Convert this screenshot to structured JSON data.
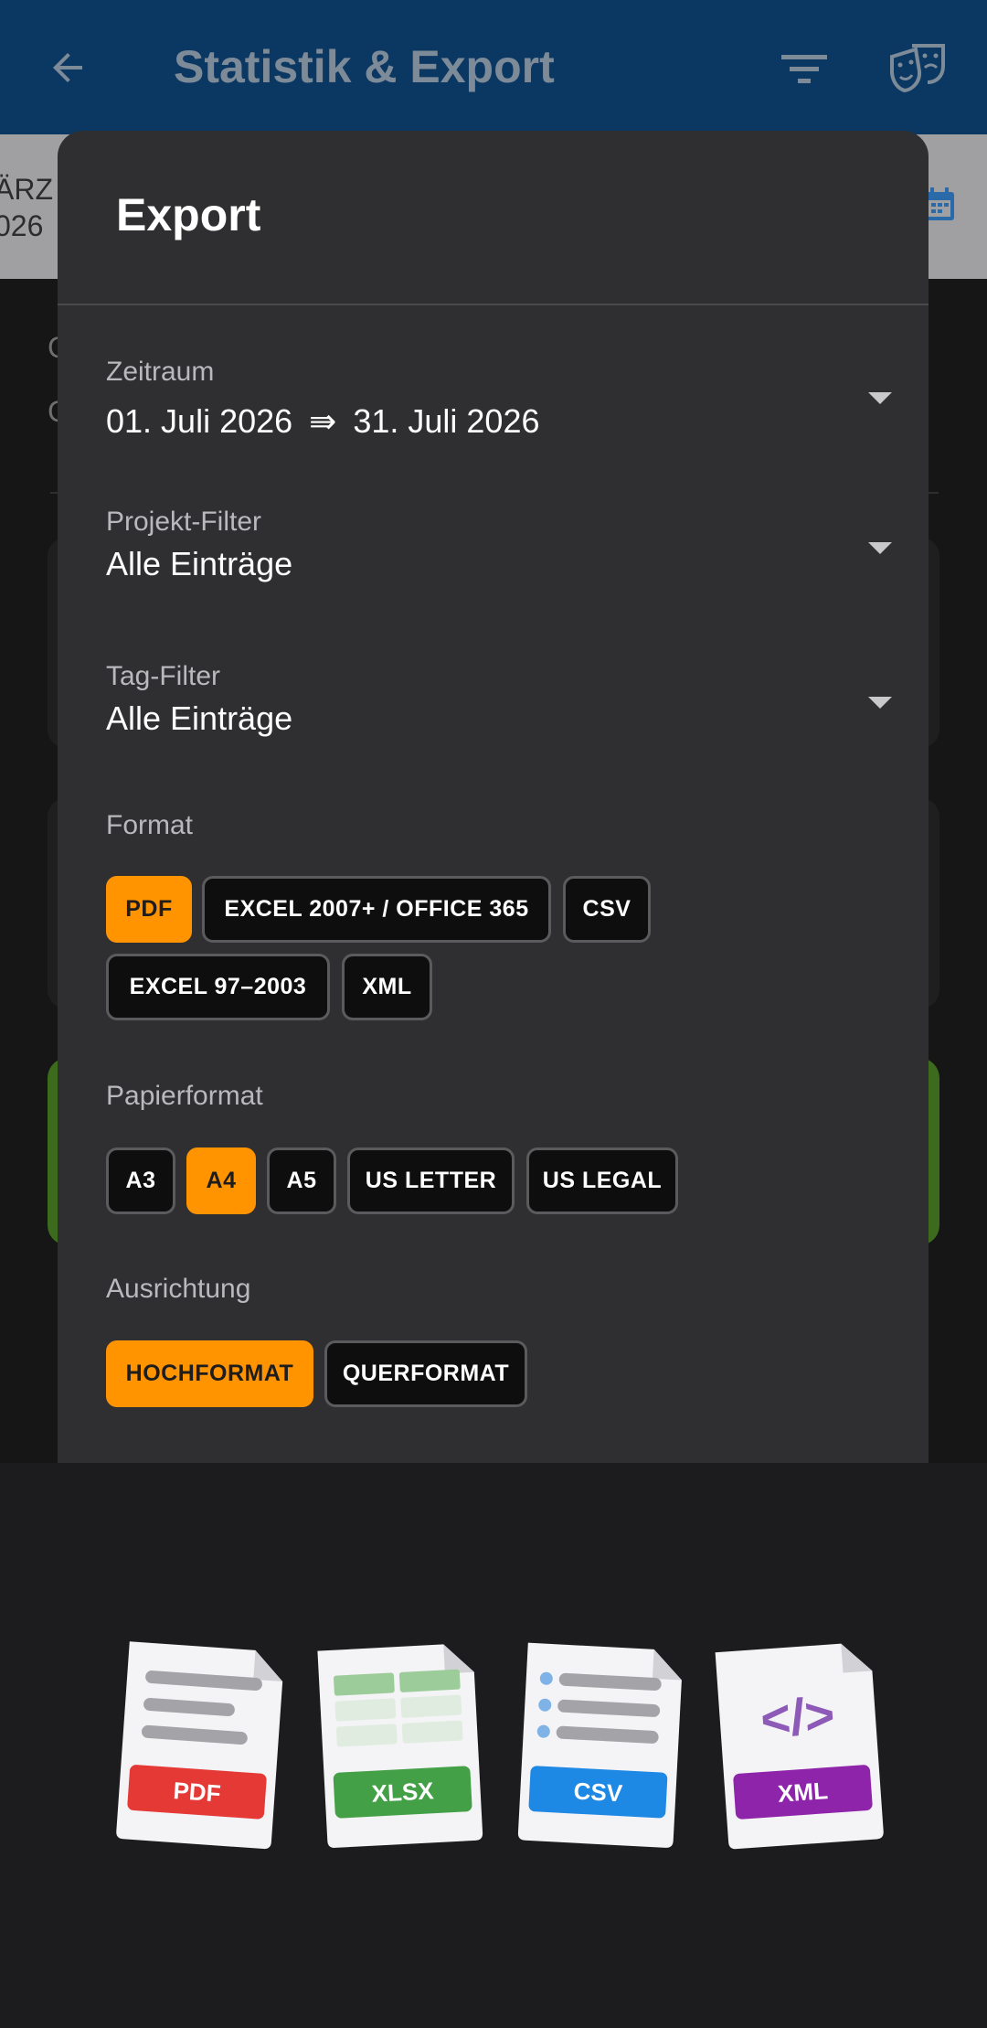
{
  "app_bar": {
    "title": "Statistik & Export",
    "back_icon": "arrow-back-icon",
    "filter_icon": "filter-list-icon",
    "theme_icon": "theater-masks-icon"
  },
  "background": {
    "date_fragment_line1": "ÄRZ",
    "date_fragment_line2": "026",
    "letter_1": "C",
    "letter_2": "C"
  },
  "dialog": {
    "title": "Export",
    "period": {
      "label": "Zeitraum",
      "start": "01. Juli 2026",
      "separator": "⇛",
      "end": "31. Juli 2026"
    },
    "project_filter": {
      "label": "Projekt-Filter",
      "value": "Alle Einträge"
    },
    "tag_filter": {
      "label": "Tag-Filter",
      "value": "Alle Einträge"
    },
    "format": {
      "label": "Format",
      "options": [
        "PDF",
        "EXCEL 2007+ / OFFICE 365",
        "CSV",
        "EXCEL 97–2003",
        "XML"
      ],
      "selected": "PDF"
    },
    "paper": {
      "label": "Papierformat",
      "options": [
        "A3",
        "A4",
        "A5",
        "US LETTER",
        "US LEGAL"
      ],
      "selected": "A4"
    },
    "orientation": {
      "label": "Ausrichtung",
      "options": [
        "HOCHFORMAT",
        "QUERFORMAT"
      ],
      "selected": "HOCHFORMAT"
    }
  },
  "file_icons": [
    {
      "label": "PDF",
      "color": "#e53935"
    },
    {
      "label": "XLSX",
      "color": "#43a047"
    },
    {
      "label": "CSV",
      "color": "#1e88e5"
    },
    {
      "label": "XML",
      "color": "#8e24aa",
      "glyph": "</>"
    }
  ],
  "colors": {
    "app_bar": "#0b3863",
    "dialog": "#2f2f31",
    "accent_selected": "#ff9400"
  }
}
